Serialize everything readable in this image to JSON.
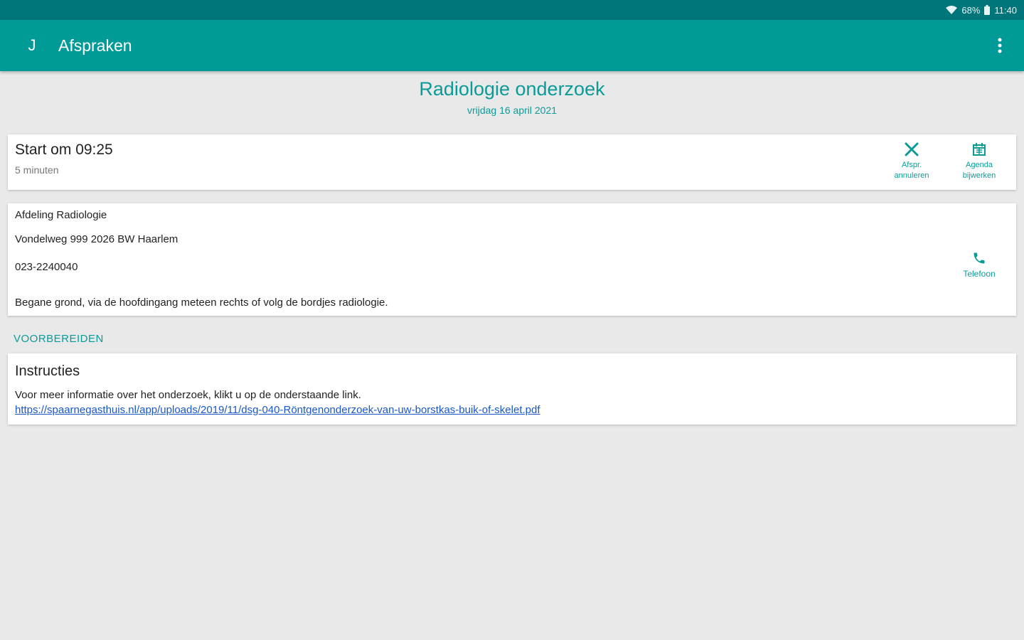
{
  "status_bar": {
    "battery": "68%",
    "time": "11:40",
    "icons": [
      "wifi-icon",
      "battery-icon"
    ]
  },
  "app_bar": {
    "nav_letter": "J",
    "title": "Afspraken",
    "overflow_icon": "more-vert-icon"
  },
  "appointment": {
    "title": "Radiologie onderzoek",
    "date": "vrijdag 16 april 2021"
  },
  "time_card": {
    "start": "Start om 09:25",
    "duration": "5 minuten",
    "actions": [
      {
        "icon": "close-icon",
        "label_line1": "Afspr.",
        "label_line2": "annuleren"
      },
      {
        "icon": "calendar-icon",
        "label_line1": "Agenda",
        "label_line2": "bijwerken"
      }
    ]
  },
  "location_card": {
    "department": "Afdeling Radiologie",
    "address": "Vondelweg 999 2026 BW Haarlem",
    "phone": "023-2240040",
    "directions": "Begane grond, via de hoofdingang meteen rechts of volg de bordjes  radiologie.",
    "phone_action": {
      "icon": "phone-icon",
      "label": "Telefoon"
    }
  },
  "prepare": {
    "section_label": "VOORBEREIDEN",
    "title": "Instructies",
    "text": "Voor meer informatie over het onderzoek, klikt u op de onderstaande link.",
    "link": "https://spaarnegasthuis.nl/app/uploads/2019/11/dsg-040-Röntgenonderzoek-van-uw-borstkas-buik-of-skelet.pdf"
  },
  "colors": {
    "status_bar": "#00757a",
    "app_bar": "#009a97",
    "accent": "#0a9b98",
    "link": "#1a58c8",
    "background": "#e9e9e9"
  }
}
